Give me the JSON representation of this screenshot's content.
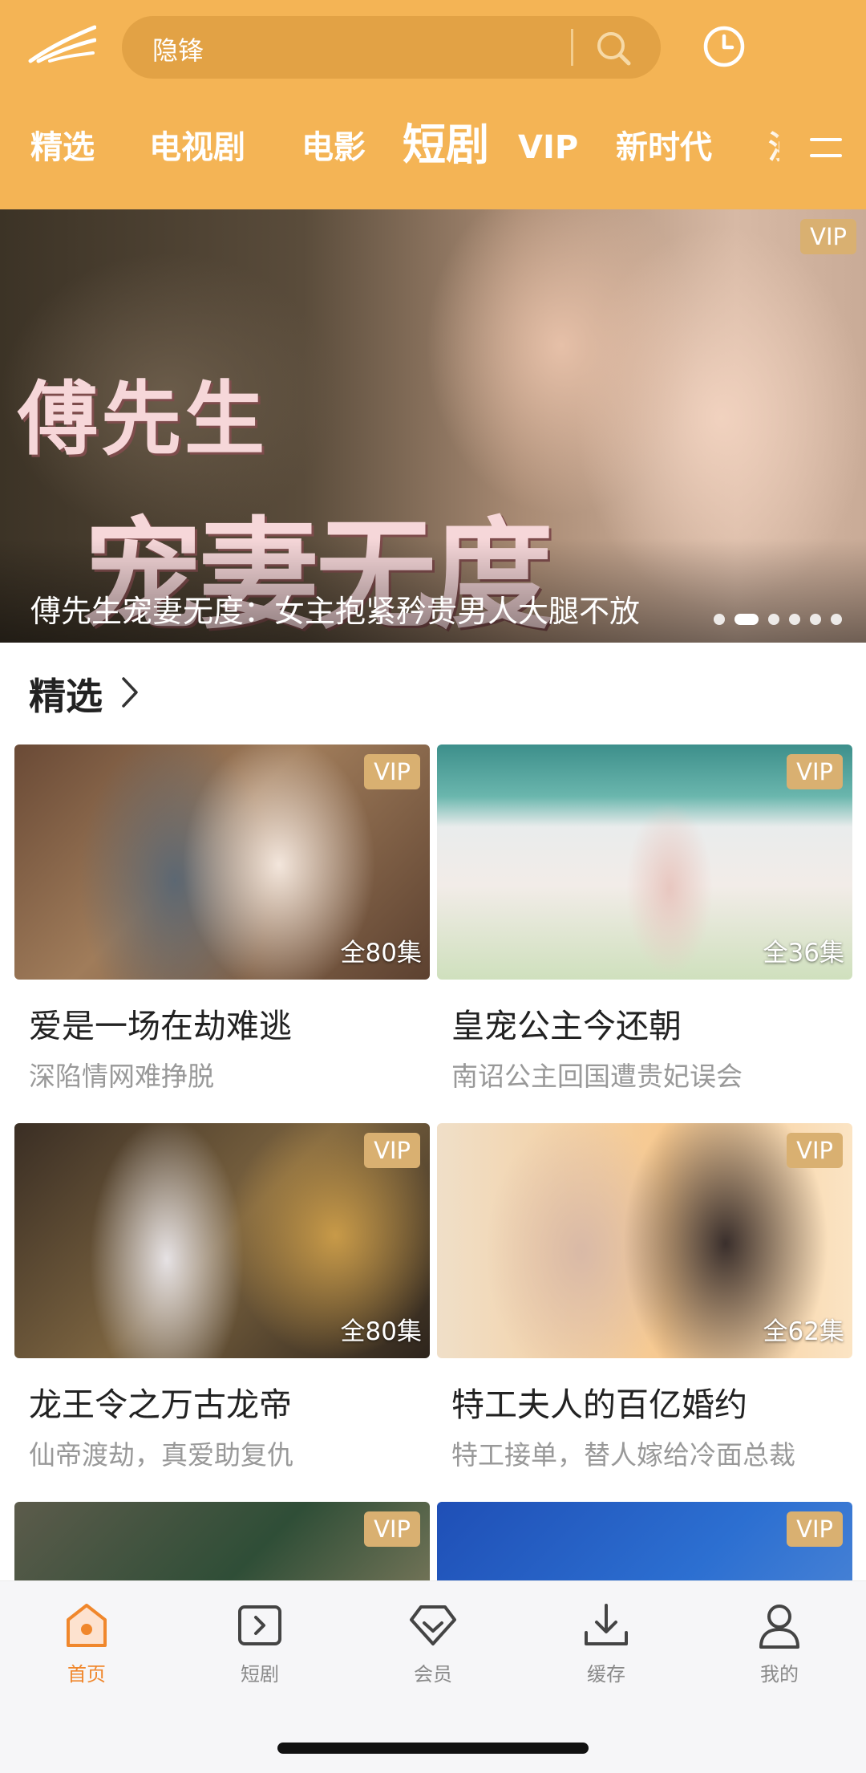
{
  "search": {
    "placeholder": "隐锋"
  },
  "tabs": [
    {
      "label": "精选"
    },
    {
      "label": "电视剧"
    },
    {
      "label": "电影"
    },
    {
      "label": "短剧"
    },
    {
      "label": "VIP"
    },
    {
      "label": "新时代"
    },
    {
      "label": "漫"
    }
  ],
  "active_tab": "短剧",
  "banner": {
    "art_line1": "傅先生",
    "art_line2": "宠妻无度",
    "caption": "傅先生宠妻无度：女主抱紧矜贵男人大腿不放",
    "badge": "VIP",
    "slide_count": 6,
    "active_slide": 2
  },
  "section": {
    "title": "精选"
  },
  "cards": [
    {
      "title": "爱是一场在劫难逃",
      "subtitle": "深陷情网难挣脱",
      "episodes": "全80集",
      "badge": "VIP"
    },
    {
      "title": "皇宠公主今还朝",
      "subtitle": "南诏公主回国遭贵妃误会",
      "episodes": "全36集",
      "badge": "VIP"
    },
    {
      "title": "龙王令之万古龙帝",
      "subtitle": "仙帝渡劫，真爱助复仇",
      "episodes": "全80集",
      "badge": "VIP"
    },
    {
      "title": "特工夫人的百亿婚约",
      "subtitle": "特工接单，替人嫁给冷面总裁",
      "episodes": "全62集",
      "badge": "VIP"
    },
    {
      "title": "",
      "subtitle": "",
      "episodes": "",
      "badge": "VIP"
    },
    {
      "title": "",
      "subtitle": "",
      "episodes": "",
      "badge": "VIP"
    }
  ],
  "nav": [
    {
      "label": "首页",
      "icon": "home-icon",
      "active": true
    },
    {
      "label": "短剧",
      "icon": "play-square-icon"
    },
    {
      "label": "会员",
      "icon": "diamond-icon"
    },
    {
      "label": "缓存",
      "icon": "download-icon"
    },
    {
      "label": "我的",
      "icon": "user-icon"
    }
  ],
  "colors": {
    "header": "#f4b455",
    "accent": "#f0872c",
    "vip_badge": "#d9b071"
  }
}
